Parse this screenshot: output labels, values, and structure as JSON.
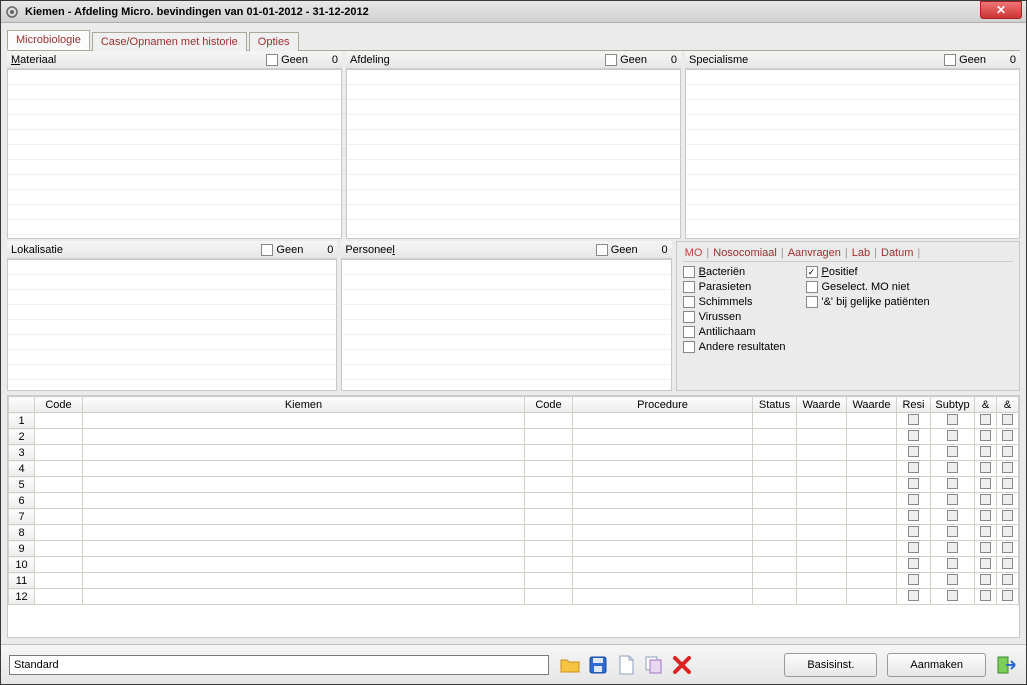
{
  "window": {
    "title": "Kiemen - Afdeling  Micro. bevindingen van 01-01-2012 - 31-12-2012"
  },
  "tabs": [
    "Microbiologie",
    "Case/Opnamen met historie",
    "Opties"
  ],
  "active_tab": 0,
  "panels": {
    "materiaal": {
      "label": "Materiaal",
      "geen_label": "Geen",
      "count": "0"
    },
    "afdeling": {
      "label": "Afdeling",
      "geen_label": "Geen",
      "count": "0"
    },
    "specialisme": {
      "label": "Specialisme",
      "geen_label": "Geen",
      "count": "0"
    },
    "lokalisatie": {
      "label": "Lokalisatie",
      "geen_label": "Geen",
      "count": "0"
    },
    "personeel": {
      "label": "Personeel",
      "geen_label": "Geen",
      "count": "0"
    }
  },
  "sub_tabs": [
    "MO",
    "Nosocomiaal",
    "Aanvragen",
    "Lab",
    "Datum"
  ],
  "checks_left": [
    {
      "label": "Bacteriën",
      "checked": false,
      "underline": "B"
    },
    {
      "label": "Parasieten",
      "checked": false
    },
    {
      "label": "Schimmels",
      "checked": false
    },
    {
      "label": "Virussen",
      "checked": false
    },
    {
      "label": "Antilichaam",
      "checked": false
    },
    {
      "label": "Andere resultaten",
      "checked": false
    }
  ],
  "checks_right": [
    {
      "label": "Positief",
      "checked": true,
      "underline": "P"
    },
    {
      "label": "Geselect. MO niet",
      "checked": false
    },
    {
      "label": "'&' bij gelijke patiënten",
      "checked": false
    }
  ],
  "grid_headers": [
    "",
    "Code",
    "Kiemen",
    "Code",
    "Procedure",
    "Status",
    "Waarde",
    "Waarde",
    "Resi",
    "Subtyp",
    "&",
    "&"
  ],
  "grid_row_count": 12,
  "footer": {
    "input_value": "Standard",
    "btn_basis": "Basisinst.",
    "btn_aanmaken": "Aanmaken"
  },
  "icons": {
    "open": "open-folder-icon",
    "save": "save-disk-icon",
    "new": "new-file-icon",
    "copy": "copy-icon",
    "delete": "delete-x-icon",
    "exit": "exit-icon"
  }
}
